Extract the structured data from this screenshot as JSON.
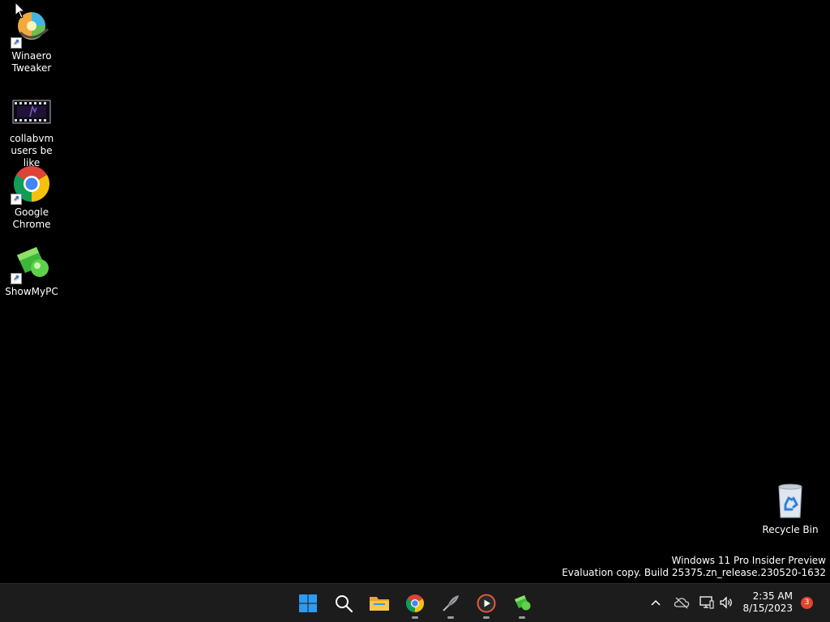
{
  "desktop": {
    "icons": [
      {
        "label_line1": "Winaero",
        "label_line2": "Tweaker",
        "icon": "winaero-tweaker-icon",
        "shortcut": true
      },
      {
        "label_line1": "collabvm",
        "label_line2": "users be like",
        "icon": "video-file-icon",
        "shortcut": false
      },
      {
        "label_line1": "Google",
        "label_line2": "Chrome",
        "icon": "chrome-icon",
        "shortcut": true
      },
      {
        "label_line1": "ShowMyPC",
        "label_line2": "",
        "icon": "showmypc-icon",
        "shortcut": true
      }
    ],
    "recycle_bin": {
      "label": "Recycle Bin",
      "icon": "recycle-bin-icon"
    }
  },
  "watermark": {
    "line1": "Windows 11 Pro Insider Preview",
    "line2": "Evaluation copy. Build 25375.zn_release.230520-1632"
  },
  "taskbar": {
    "items": [
      {
        "name": "start",
        "icon": "windows-start-icon"
      },
      {
        "name": "search",
        "icon": "search-icon"
      },
      {
        "name": "file-explorer",
        "icon": "folder-icon"
      },
      {
        "name": "chrome",
        "icon": "chrome-icon"
      },
      {
        "name": "app-quill",
        "icon": "quill-icon"
      },
      {
        "name": "media-player",
        "icon": "media-player-icon"
      },
      {
        "name": "showmypc",
        "icon": "showmypc-icon"
      }
    ],
    "tray": {
      "icons": [
        "chevron-up-icon",
        "cloud-offline-icon",
        "network-icon",
        "volume-icon"
      ],
      "time": "2:35 AM",
      "date": "8/15/2023",
      "notification_count": "3"
    }
  },
  "colors": {
    "desktop_bg": "#000000",
    "taskbar_bg": "#1c1c1c",
    "badge": "#e2452f",
    "start_blue": "#2d9cf0"
  }
}
